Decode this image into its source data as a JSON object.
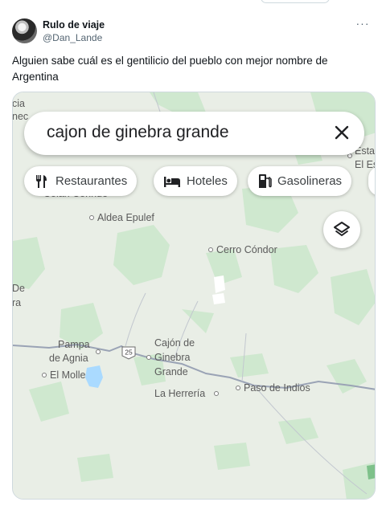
{
  "tweet": {
    "display_name": "Rulo de viaje",
    "handle": "@Dan_Lande",
    "text": "Alguien sabe cuál es el gentilicio del pueblo con mejor nombre de Argentina"
  },
  "map": {
    "search_query": "cajon de ginebra grande",
    "chips": [
      {
        "label": "Restaurantes",
        "icon": "fork-knife-icon"
      },
      {
        "label": "Hoteles",
        "icon": "bed-icon"
      },
      {
        "label": "Gasolineras",
        "icon": "gas-pump-icon"
      }
    ],
    "route_number": "25",
    "places": {
      "colan_conhue": "Colán Conhué",
      "aldea_epulef": "Aldea Epulef",
      "cerro_condor": "Cerro Cóndor",
      "pampa_de_agnia_1": "Pampa",
      "pampa_de_agnia_2": "de Agnia",
      "el_molle": "El Molle",
      "cajon_1": "Cajón de",
      "cajon_2": "Ginebra",
      "cajon_3": "Grande",
      "la_herreria": "La Herrería",
      "paso_de_indios": "Paso de Indios",
      "left_cut_1": "cia",
      "left_cut_2": "nec",
      "left_cut_3": "De",
      "left_cut_4": "ra",
      "right_cut_1": "Esta",
      "right_cut_2": "El Es"
    },
    "colors": {
      "land": "#e9eee6",
      "vegetation": "#c8e6c9",
      "water": "#aadaff",
      "road": "#9aa3b5"
    }
  }
}
